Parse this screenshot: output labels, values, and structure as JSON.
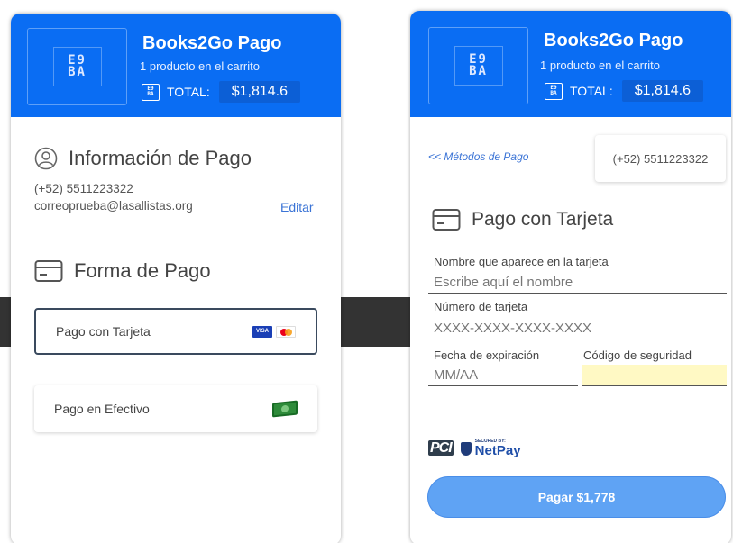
{
  "brand": {
    "logo_glyph_top": "E9",
    "logo_glyph_bottom": "BA"
  },
  "header": {
    "title": "Books2Go Pago",
    "subtitle": "1 producto en el carrito",
    "total_label": "TOTAL:",
    "total_value": "$1,814.6",
    "color": "#0a6df3"
  },
  "left_panel": {
    "info_section": {
      "title": "Información de Pago",
      "phone": "(+52) 5511223322",
      "email": "correoprueba@lasallistas.org",
      "edit_link": "Editar"
    },
    "payment_section": {
      "title": "Forma de Pago",
      "methods": [
        {
          "label": "Pago con Tarjeta",
          "icon": "card-brands-icon",
          "selected": true
        },
        {
          "label": "Pago en Efectivo",
          "icon": "cash-icon",
          "selected": false
        }
      ]
    }
  },
  "right_panel": {
    "back_link": "<< Métodos de Pago",
    "phone": "(+52) 5511223322",
    "card_section_title": "Pago con Tarjeta",
    "fields": {
      "name": {
        "label": "Nombre que aparece en la tarjeta",
        "placeholder": "Escribe aquí el nombre"
      },
      "number": {
        "label": "Número de tarjeta",
        "placeholder": "XXXX-XXXX-XXXX-XXXX"
      },
      "expiry": {
        "label": "Fecha de expiración",
        "placeholder": "MM/AA"
      },
      "cvv": {
        "label": "Código de seguridad",
        "placeholder": ""
      }
    },
    "secure": {
      "pci": "PCI",
      "netpay_small": "SECURED BY:",
      "netpay": "NetPay"
    },
    "pay_button": "Pagar $1,778"
  }
}
